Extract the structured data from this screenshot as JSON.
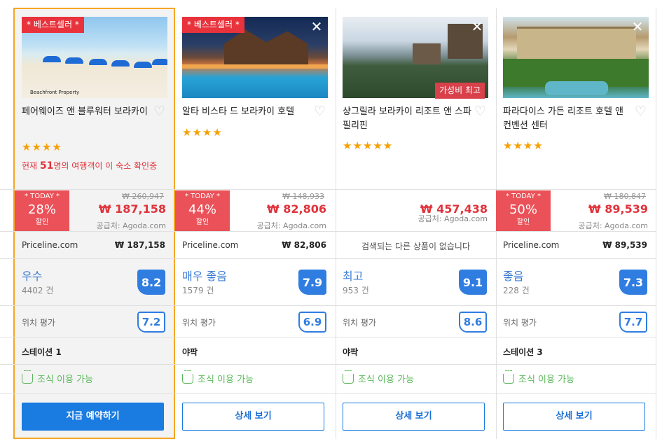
{
  "colors": {
    "accent": "#1a7be0",
    "sale_red": "#ea5158",
    "price_red": "#e0333c",
    "highlight_border": "#f5a623",
    "breakfast_green": "#5cb85c"
  },
  "hotels": [
    {
      "badge": "* 베스트셀러 *",
      "photo_caption": "Beachfront Property",
      "name": "페어웨이즈 앤 블루워터 보라카이",
      "stars": "★★★★",
      "viewers_prefix": "현재 ",
      "viewers_count": "51",
      "viewers_suffix": "명의 여행객이 이 숙소 확인중",
      "today_label": "* TODAY *",
      "discount": "28%",
      "discount_label": "할인",
      "old_price": "₩ 260,947",
      "price": "₩ 187,158",
      "supplier": "공급처: Agoda.com",
      "partner_name": "Priceline.com",
      "partner_price": "₩  187,158",
      "rating_label": "우수",
      "review_count": "4402 건",
      "score": "8.2",
      "location_label": "위치 평가",
      "location_score": "7.2",
      "station": "스테이션 1",
      "breakfast": "조식 이용 가능",
      "button": "지금 예약하기"
    },
    {
      "badge": "* 베스트셀러 *",
      "name": "알타 비스타 드 보라카이 호텔",
      "stars": "★★★★",
      "today_label": "* TODAY *",
      "discount": "44%",
      "discount_label": "할인",
      "old_price": "₩ 148,933",
      "price": "₩ 82,806",
      "supplier": "공급처: Agoda.com",
      "partner_name": "Priceline.com",
      "partner_price": "₩  82,806",
      "rating_label": "매우 좋음",
      "review_count": "1579 건",
      "score": "7.9",
      "location_label": "위치 평가",
      "location_score": "6.9",
      "station": "야팍",
      "breakfast": "조식 이용 가능",
      "button": "상세 보기"
    },
    {
      "value_badge": "가성비 최고",
      "name": "샹그릴라 보라카이 리조트 앤 스파 필리핀",
      "stars": "★★★★★",
      "price": "₩ 457,438",
      "supplier": "공급처: Agoda.com",
      "no_results": "검색되는 다른 상품이 없습니다",
      "rating_label": "최고",
      "review_count": "953 건",
      "score": "9.1",
      "location_label": "위치 평가",
      "location_score": "8.6",
      "station": "야팍",
      "breakfast": "조식 이용 가능",
      "button": "상세 보기"
    },
    {
      "name": "파라다이스 가든 리조트 호텔 앤 컨벤션 센터",
      "stars": "★★★★",
      "today_label": "* TODAY *",
      "discount": "50%",
      "discount_label": "할인",
      "old_price": "₩ 180,847",
      "price": "₩ 89,539",
      "supplier": "공급처: Agoda.com",
      "partner_name": "Priceline.com",
      "partner_price": "₩  89,539",
      "rating_label": "좋음",
      "review_count": "228 건",
      "score": "7.3",
      "location_label": "위치 평가",
      "location_score": "7.7",
      "station": "스테이션 3",
      "breakfast": "조식 이용 가능",
      "button": "상세 보기"
    }
  ]
}
